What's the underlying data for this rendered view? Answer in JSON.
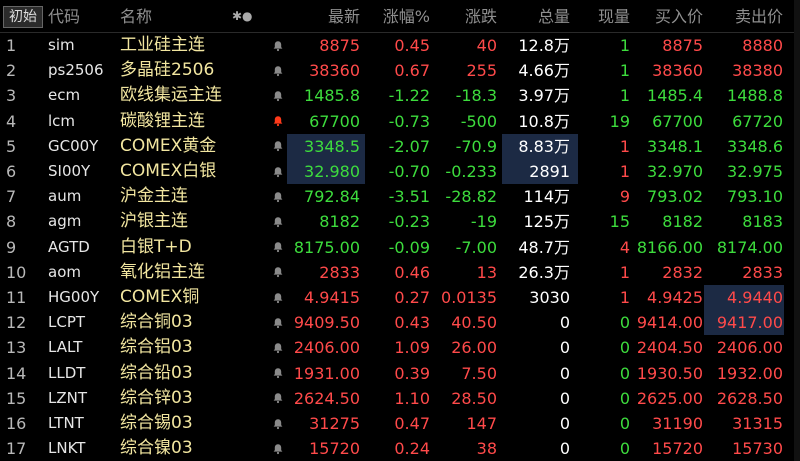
{
  "header": {
    "init_button": "初始",
    "code": "代码",
    "name": "名称",
    "flags": "✱●",
    "last": "最新",
    "pct": "涨幅%",
    "chg": "涨跌",
    "vol": "总量",
    "cur": "现量",
    "bid": "买入价",
    "ask": "卖出价"
  },
  "colors": {
    "up": "#ff4a4a",
    "down": "#3ddc3d",
    "name": "#f2e6a0",
    "highlight": "#1c2a44",
    "bell_active": "#ff3a1a"
  },
  "rows": [
    {
      "idx": "1",
      "code": "sim",
      "name": "工业硅主连",
      "alert": false,
      "last": "8875",
      "pct": "0.45",
      "chg": "40",
      "vol": "12.8万",
      "cur": "1",
      "bid": "8875",
      "ask": "8880",
      "dir": "up",
      "cur_dir": "down",
      "bid_dir": "up",
      "ask_dir": "up"
    },
    {
      "idx": "2",
      "code": "ps2506",
      "name": "多晶硅2506",
      "alert": false,
      "last": "38360",
      "pct": "0.67",
      "chg": "255",
      "vol": "4.66万",
      "cur": "1",
      "bid": "38360",
      "ask": "38380",
      "dir": "up",
      "cur_dir": "down",
      "bid_dir": "up",
      "ask_dir": "up"
    },
    {
      "idx": "3",
      "code": "ecm",
      "name": "欧线集运主连",
      "alert": false,
      "last": "1485.8",
      "pct": "-1.22",
      "chg": "-18.3",
      "vol": "3.97万",
      "cur": "1",
      "bid": "1485.4",
      "ask": "1488.8",
      "dir": "down",
      "cur_dir": "down",
      "bid_dir": "down",
      "ask_dir": "down"
    },
    {
      "idx": "4",
      "code": "lcm",
      "name": "碳酸锂主连",
      "alert": true,
      "last": "67700",
      "pct": "-0.73",
      "chg": "-500",
      "vol": "10.8万",
      "cur": "19",
      "bid": "67700",
      "ask": "67720",
      "dir": "down",
      "cur_dir": "down",
      "bid_dir": "down",
      "ask_dir": "down"
    },
    {
      "idx": "5",
      "code": "GC00Y",
      "name": "COMEX黄金",
      "alert": false,
      "last": "3348.5",
      "pct": "-2.07",
      "chg": "-70.9",
      "vol": "8.83万",
      "cur": "1",
      "bid": "3348.1",
      "ask": "3348.6",
      "dir": "down",
      "cur_dir": "up",
      "bid_dir": "down",
      "ask_dir": "down"
    },
    {
      "idx": "6",
      "code": "SI00Y",
      "name": "COMEX白银",
      "alert": false,
      "last": "32.980",
      "pct": "-0.70",
      "chg": "-0.233",
      "vol": "2891",
      "cur": "1",
      "bid": "32.970",
      "ask": "32.975",
      "dir": "down",
      "cur_dir": "up",
      "bid_dir": "down",
      "ask_dir": "down"
    },
    {
      "idx": "7",
      "code": "aum",
      "name": "沪金主连",
      "alert": false,
      "last": "792.84",
      "pct": "-3.51",
      "chg": "-28.82",
      "vol": "114万",
      "cur": "9",
      "bid": "793.02",
      "ask": "793.10",
      "dir": "down",
      "cur_dir": "up",
      "bid_dir": "down",
      "ask_dir": "down"
    },
    {
      "idx": "8",
      "code": "agm",
      "name": "沪银主连",
      "alert": false,
      "last": "8182",
      "pct": "-0.23",
      "chg": "-19",
      "vol": "125万",
      "cur": "15",
      "bid": "8182",
      "ask": "8183",
      "dir": "down",
      "cur_dir": "down",
      "bid_dir": "down",
      "ask_dir": "down"
    },
    {
      "idx": "9",
      "code": "AGTD",
      "name": "白银T+D",
      "alert": false,
      "last": "8175.00",
      "pct": "-0.09",
      "chg": "-7.00",
      "vol": "48.7万",
      "cur": "4",
      "bid": "8166.00",
      "ask": "8174.00",
      "dir": "down",
      "cur_dir": "up",
      "bid_dir": "down",
      "ask_dir": "down"
    },
    {
      "idx": "10",
      "code": "aom",
      "name": "氧化铝主连",
      "alert": false,
      "last": "2833",
      "pct": "0.46",
      "chg": "13",
      "vol": "26.3万",
      "cur": "1",
      "bid": "2832",
      "ask": "2833",
      "dir": "up",
      "cur_dir": "up",
      "bid_dir": "up",
      "ask_dir": "up"
    },
    {
      "idx": "11",
      "code": "HG00Y",
      "name": "COMEX铜",
      "alert": false,
      "last": "4.9415",
      "pct": "0.27",
      "chg": "0.0135",
      "vol": "3030",
      "cur": "1",
      "bid": "4.9425",
      "ask": "4.9440",
      "dir": "up",
      "cur_dir": "up",
      "bid_dir": "up",
      "ask_dir": "up"
    },
    {
      "idx": "12",
      "code": "LCPT",
      "name": "综合铜03",
      "alert": false,
      "last": "9409.50",
      "pct": "0.43",
      "chg": "40.50",
      "vol": "0",
      "cur": "0",
      "bid": "9414.00",
      "ask": "9417.00",
      "dir": "up",
      "cur_dir": "down",
      "bid_dir": "up",
      "ask_dir": "up"
    },
    {
      "idx": "13",
      "code": "LALT",
      "name": "综合铝03",
      "alert": false,
      "last": "2406.00",
      "pct": "1.09",
      "chg": "26.00",
      "vol": "0",
      "cur": "0",
      "bid": "2404.50",
      "ask": "2406.00",
      "dir": "up",
      "cur_dir": "down",
      "bid_dir": "up",
      "ask_dir": "up"
    },
    {
      "idx": "14",
      "code": "LLDT",
      "name": "综合铅03",
      "alert": false,
      "last": "1931.00",
      "pct": "0.39",
      "chg": "7.50",
      "vol": "0",
      "cur": "0",
      "bid": "1930.50",
      "ask": "1932.00",
      "dir": "up",
      "cur_dir": "down",
      "bid_dir": "up",
      "ask_dir": "up"
    },
    {
      "idx": "15",
      "code": "LZNT",
      "name": "综合锌03",
      "alert": false,
      "last": "2624.50",
      "pct": "1.10",
      "chg": "28.50",
      "vol": "0",
      "cur": "0",
      "bid": "2625.00",
      "ask": "2628.50",
      "dir": "up",
      "cur_dir": "down",
      "bid_dir": "up",
      "ask_dir": "up"
    },
    {
      "idx": "16",
      "code": "LTNT",
      "name": "综合锡03",
      "alert": false,
      "last": "31275",
      "pct": "0.47",
      "chg": "147",
      "vol": "0",
      "cur": "0",
      "bid": "31190",
      "ask": "31315",
      "dir": "up",
      "cur_dir": "down",
      "bid_dir": "up",
      "ask_dir": "up"
    },
    {
      "idx": "17",
      "code": "LNKT",
      "name": "综合镍03",
      "alert": false,
      "last": "15720",
      "pct": "0.24",
      "chg": "38",
      "vol": "0",
      "cur": "0",
      "bid": "15720",
      "ask": "15730",
      "dir": "up",
      "cur_dir": "down",
      "bid_dir": "up",
      "ask_dir": "up"
    }
  ]
}
